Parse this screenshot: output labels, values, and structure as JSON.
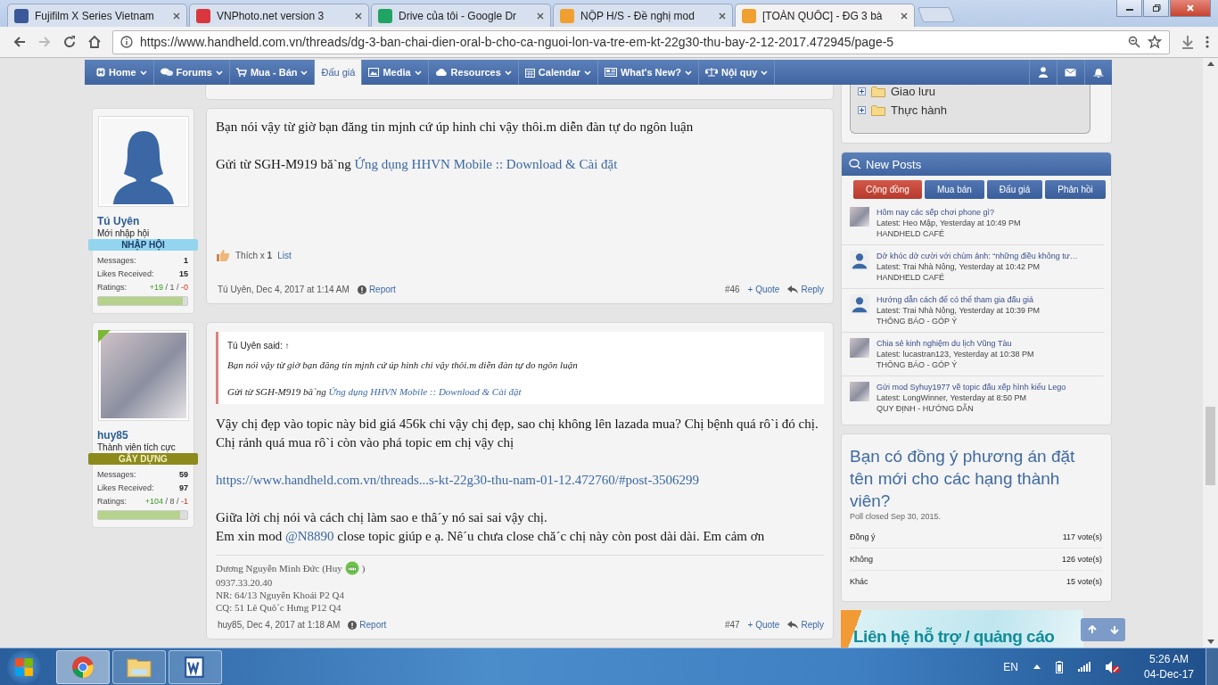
{
  "browser": {
    "tabs": [
      {
        "title": "Fujifilm X Series Vietnam",
        "selected": false
      },
      {
        "title": "VNPhoto.net version 3",
        "selected": false
      },
      {
        "title": "Drive của tôi - Google Dr",
        "selected": false
      },
      {
        "title": "NỘP H/S - Đề nghị mod",
        "selected": false
      },
      {
        "title": "[TOÀN QUỐC] - ĐG 3 bà",
        "selected": true
      }
    ],
    "url": "https://www.handheld.com.vn/threads/dg-3-ban-chai-dien-oral-b-cho-ca-nguoi-lon-va-tre-em-kt-22g30-thu-bay-2-12-2017.472945/page-5"
  },
  "navbar": {
    "items": [
      {
        "label": "Home",
        "selected": false,
        "menu": true
      },
      {
        "label": "Forums",
        "selected": false,
        "menu": true
      },
      {
        "label": "Mua - Bán",
        "selected": false,
        "menu": true
      },
      {
        "label": "Đấu giá",
        "selected": true,
        "menu": false
      },
      {
        "label": "Media",
        "selected": false,
        "menu": true
      },
      {
        "label": "Resources",
        "selected": false,
        "menu": true
      },
      {
        "label": "Calendar",
        "selected": false,
        "menu": true
      },
      {
        "label": "What's New?",
        "selected": false,
        "menu": true
      },
      {
        "label": "Nội quy",
        "selected": false,
        "menu": true
      }
    ]
  },
  "posts": [
    {
      "author": "Tú Uyên",
      "user_title": "Mới nhập hội",
      "online": false,
      "avatar": {
        "kind": "silhouette"
      },
      "rank": {
        "label": "NHẬP HỘI",
        "color": "#93d5ef"
      },
      "stats": [
        {
          "label": "Messages:",
          "value": "1"
        },
        {
          "label": "Likes Received:",
          "value": "15"
        }
      ],
      "ratings": {
        "label": "Ratings:",
        "values": [
          "+19",
          "1",
          "-0"
        ],
        "separator": " / ",
        "level": 0.95
      },
      "paragraphs": [
        {
          "lines": [
            [
              {
                "text": "Bạn nói vậy từ giờ bạn đăng tin mjnh cứ úp hinh chi vậy thôi.m diễn đàn tự do ngôn luận"
              }
            ]
          ]
        },
        {
          "lines": [
            [
              {
                "text": "Gửi từ SGH-M919 bă`ng "
              },
              {
                "link": "Ứng dụng HHVN Mobile :: Download & Cài đặt"
              }
            ]
          ]
        }
      ],
      "likes": {
        "text": "Thích x **1**",
        "link": "List"
      },
      "footer": {
        "byline": "Tú Uyên, Dec 4, 2017 at 1:14 AM",
        "report": "Report",
        "number": "#46",
        "quote": "+ Quote",
        "reply": "Reply"
      }
    },
    {
      "author": "huy85",
      "user_title": "Thành viên tích cực",
      "online": true,
      "avatar": {
        "kind": "photo"
      },
      "rank": {
        "label": "GÂY DỰNG",
        "color": "#8c8a1c"
      },
      "stats": [
        {
          "label": "Messages:",
          "value": "59"
        },
        {
          "label": "Likes Received:",
          "value": "97"
        }
      ],
      "ratings": {
        "label": "Ratings:",
        "values": [
          "+104",
          "8",
          "-1"
        ],
        "separator": " / ",
        "level": 0.92
      },
      "quote": {
        "attribution": "Tú Uyên said: ↑",
        "paragraphs": [
          {
            "lines": [
              [
                {
                  "text": "Bạn nói vậy từ giờ bạn đăng tin mjnh cứ úp hinh chi vậy thôi.m diễn đàn tự do ngôn luận"
                }
              ]
            ]
          },
          {
            "lines": [
              [
                {
                  "text": "Gửi từ SGH-M919 bă`ng "
                },
                {
                  "link": "Ứng dụng HHVN Mobile :: Download & Cài đặt"
                }
              ]
            ]
          }
        ]
      },
      "paragraphs": [
        {
          "lines": [
            [
              {
                "text": "Vậy chị đẹp vào topic này bid giá 456k chi vậy chị đẹp, sao chị không lên lazada mua? Chị bệnh quá rô`i đó chị. Chị rảnh quá mua rô`i còn vào phá topic em chị vậy chị"
              }
            ]
          ]
        },
        {
          "lines": [
            [
              {
                "link": "https://www.handheld.com.vn/threads...s-kt-22g30-thu-nam-01-12.472760/#post-3506299"
              }
            ]
          ]
        },
        {
          "lines": [
            [
              {
                "text": "Giữa lời chị nói và cách chị làm sao e thâ´y nó sai sai vậy chị."
              }
            ],
            [
              {
                "text": "Em xin mod "
              },
              {
                "link": "@N8890"
              },
              {
                "text": " close topic giúp e ạ. Nê´u chưa close chă´c chị này còn post dài dài. Em cảm ơn"
              }
            ]
          ]
        }
      ],
      "signature": [
        {
          "text": "Dương Nguyễn Minh Đức (Huy",
          "after": ")"
        },
        {
          "text": "0937.33.20.40"
        },
        {
          "text": "NR: 64/13 Nguyễn Khoái P2 Q4"
        },
        {
          "text": "CQ: 51 Lê Quô´c Hưng P12 Q4"
        }
      ],
      "footer": {
        "byline": "huy85, Dec 4, 2017 at 1:18 AM",
        "report": "Report",
        "number": "#47",
        "quote": "+ Quote",
        "reply": "Reply"
      }
    }
  ],
  "forum_tree": {
    "items": [
      {
        "label": "Giao lưu",
        "expanded": false
      },
      {
        "label": "Thực hành",
        "expanded": false
      }
    ]
  },
  "new_posts": {
    "title": "New Posts",
    "tabs": [
      {
        "label": "Cộng đồng",
        "selected": true
      },
      {
        "label": "Mua bán",
        "selected": false
      },
      {
        "label": "Đấu giá",
        "selected": false
      },
      {
        "label": "Phản hồi",
        "selected": false
      }
    ],
    "items": [
      {
        "title": "Hôm nay các sếp chơi phone gì?",
        "latest": "Latest: Heo Mập, Yesterday at 10:49 PM",
        "forum": "HANDHELD CAFÉ",
        "avatar": {
          "kind": "photo"
        }
      },
      {
        "title": "Dở khóc dở cười với chùm ảnh: “những điều không tư…",
        "latest": "Latest: Trai Nhà Nông, Yesterday at 10:42 PM",
        "forum": "HANDHELD CAFÉ",
        "avatar": {
          "kind": "silhouette"
        }
      },
      {
        "title": "Hướng dẫn cách để có thể tham gia đấu giá",
        "latest": "Latest: Trai Nhà Nông, Yesterday at 10:39 PM",
        "forum": "THÔNG BÁO - GÓP Ý",
        "avatar": {
          "kind": "silhouette"
        }
      },
      {
        "title": "Chia sẻ kinh nghiệm du lịch Vũng Tàu",
        "latest": "Latest: lucastran123, Yesterday at 10:38 PM",
        "forum": "THÔNG BÁO - GÓP Ý",
        "avatar": {
          "kind": "photo"
        }
      },
      {
        "title": "Gửi mod Syhuy1977 về topic đấu xếp hình kiểu Lego",
        "latest": "Latest: LongWinner, Yesterday at 8:50 PM",
        "forum": "QUY ĐỊNH - HƯỚNG DẪN",
        "avatar": {
          "kind": "photo"
        }
      }
    ]
  },
  "poll": {
    "question": "Bạn có đồng ý phương án đặt tên mới cho các hạng thành viên?",
    "status": "Poll closed Sep 30, 2015.",
    "options": [
      {
        "label": "Đồng ý",
        "votes": "117 vote(s)"
      },
      {
        "label": "Không",
        "votes": "126 vote(s)"
      },
      {
        "label": "Khác",
        "votes": "15 vote(s)"
      }
    ]
  },
  "ad": {
    "text": "Liên hệ hỗ trợ / quảng cáo"
  },
  "taskbar": {
    "language": "EN",
    "time": "5:26 AM",
    "date": "04-Dec-17"
  }
}
